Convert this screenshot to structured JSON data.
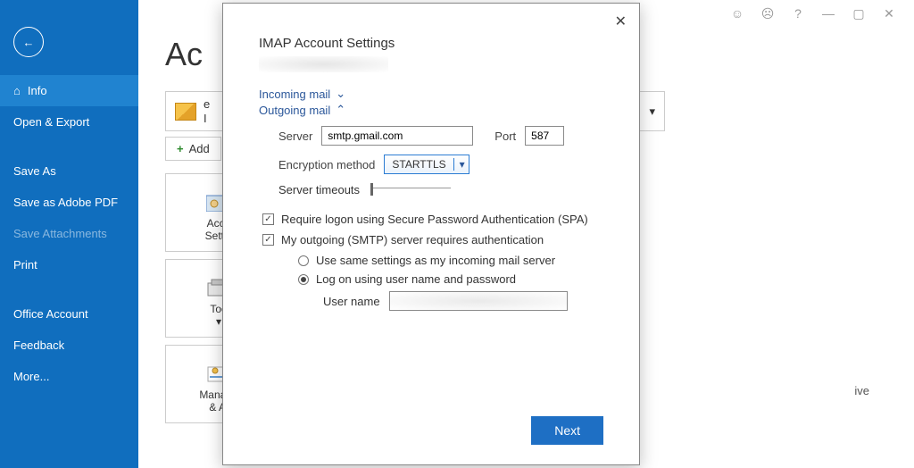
{
  "titlebar": {
    "smiley_label": "☺",
    "sad_label": "☹",
    "help_label": "?",
    "min_label": "—",
    "max_label": "▢",
    "close_label": "✕"
  },
  "sidebar": {
    "back_glyph": "←",
    "items": [
      {
        "label": "Info",
        "icon": "⌂"
      },
      {
        "label": "Open & Export"
      },
      {
        "label": "Save As"
      },
      {
        "label": "Save as Adobe PDF"
      },
      {
        "label": "Save Attachments"
      },
      {
        "label": "Print"
      },
      {
        "label": "Office Account"
      },
      {
        "label": "Feedback"
      },
      {
        "label": "More..."
      }
    ]
  },
  "main": {
    "title_partial": "Ac",
    "email_prefix": "e",
    "email_suffix": "I",
    "add_account": "Add",
    "dropdown_glyph": "▾",
    "tiles": [
      {
        "line1": "Acco",
        "line2": "Settin"
      },
      {
        "line1": "Too",
        "line2": ""
      },
      {
        "line1": "Manage",
        "line2": "& Al"
      }
    ],
    "side_text": "ive"
  },
  "modal": {
    "close_glyph": "✕",
    "title": "IMAP Account Settings",
    "sections": {
      "incoming": {
        "label": "Incoming mail",
        "chevron": "⌄"
      },
      "outgoing": {
        "label": "Outgoing mail",
        "chevron": "⌃"
      }
    },
    "fields": {
      "server_label": "Server",
      "server_value": "smtp.gmail.com",
      "port_label": "Port",
      "port_value": "587",
      "encryption_label": "Encryption method",
      "encryption_value": "STARTTLS",
      "encryption_chevron": "▾",
      "timeouts_label": "Server timeouts",
      "spa_label": "Require logon using Secure Password Authentication (SPA)",
      "smtp_auth_label": "My outgoing (SMTP) server requires authentication",
      "radio_same": "Use same settings as my incoming mail server",
      "radio_logon": "Log on using user name and password",
      "username_label": "User name"
    },
    "next_button": "Next"
  }
}
